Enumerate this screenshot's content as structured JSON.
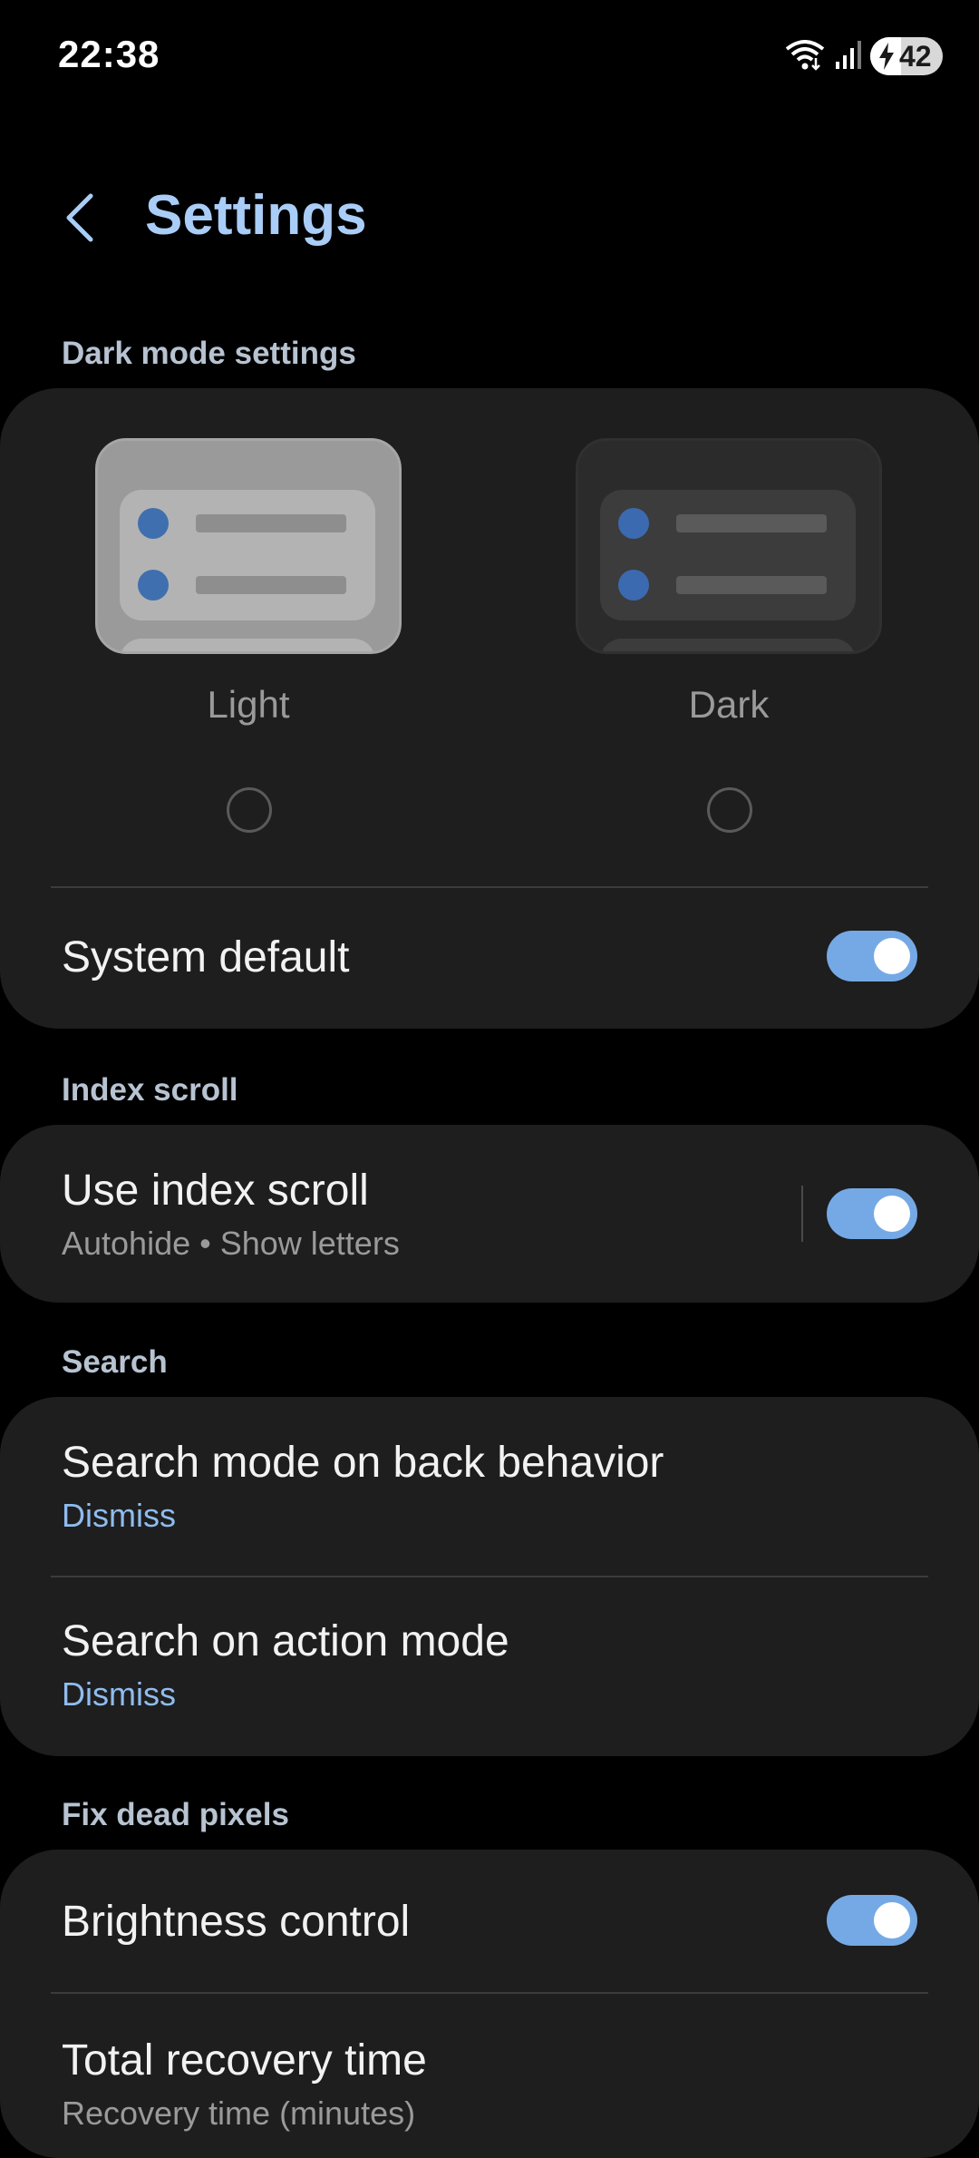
{
  "status_bar": {
    "time": "22:38",
    "battery_percent": "42",
    "battery_level": 0.42,
    "charging": true
  },
  "header": {
    "title": "Settings"
  },
  "dark_mode": {
    "section_label": "Dark mode settings",
    "options": [
      {
        "label": "Light",
        "selected": false
      },
      {
        "label": "Dark",
        "selected": false
      }
    ],
    "system_default": {
      "label": "System default",
      "enabled": true
    }
  },
  "index_scroll": {
    "section_label": "Index scroll",
    "title": "Use index scroll",
    "summary": "Autohide • Show letters",
    "enabled": true
  },
  "search": {
    "section_label": "Search",
    "items": [
      {
        "title": "Search mode on back behavior",
        "value": "Dismiss"
      },
      {
        "title": "Search on action mode",
        "value": "Dismiss"
      }
    ]
  },
  "fix_dead_pixels": {
    "section_label": "Fix dead pixels",
    "brightness_control": {
      "label": "Brightness control",
      "enabled": true
    },
    "recovery_time": {
      "title": "Total recovery time",
      "summary": "Recovery time (minutes)"
    }
  },
  "colors": {
    "accent": "#75a9e6",
    "title": "#a9cdf7",
    "card": "#1e1e1e",
    "background": "#000000"
  }
}
